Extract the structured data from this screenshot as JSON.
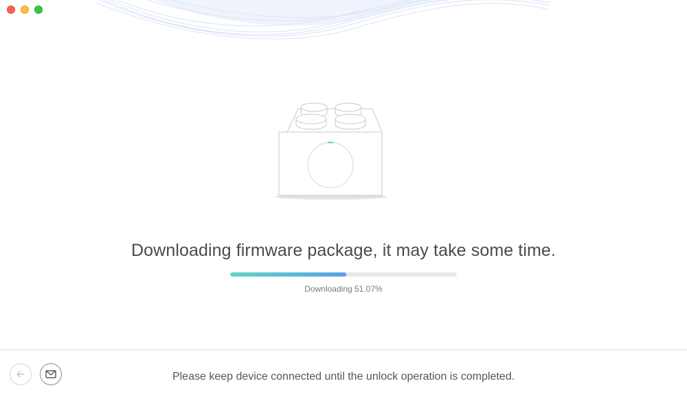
{
  "window": {
    "controls": [
      "close",
      "minimize",
      "maximize"
    ]
  },
  "main": {
    "headline": "Downloading firmware package, it may take some time.",
    "progress": {
      "fraction": 0.5107,
      "label": "Downloading 51.07%"
    },
    "graphic_icon": "firmware-package-icon"
  },
  "footer": {
    "back_icon": "arrow-left-icon",
    "mail_icon": "envelope-icon",
    "message": "Please keep device connected until the unlock operation is completed."
  },
  "colors": {
    "progress_start": "#5fd4c4",
    "progress_end": "#5a9ee6",
    "track": "#e6e8eb"
  }
}
